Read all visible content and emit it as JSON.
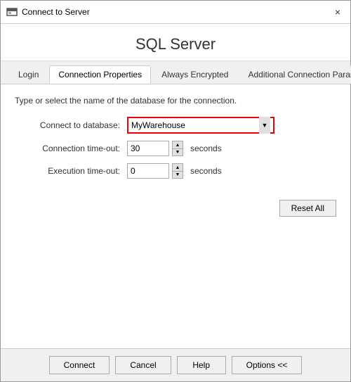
{
  "window": {
    "title": "Connect to Server",
    "close_label": "×"
  },
  "header": {
    "title": "SQL Server"
  },
  "tabs": [
    {
      "id": "login",
      "label": "Login",
      "active": false
    },
    {
      "id": "connection-properties",
      "label": "Connection Properties",
      "active": true
    },
    {
      "id": "always-encrypted",
      "label": "Always Encrypted",
      "active": false
    },
    {
      "id": "additional-connection-parameters",
      "label": "Additional Connection Parameters",
      "active": false
    }
  ],
  "content": {
    "description": "Type or select the name of the database for the connection.",
    "fields": [
      {
        "label": "Connect to database:",
        "type": "dropdown",
        "value": "MyWarehouse"
      },
      {
        "label": "Connection time-out:",
        "type": "spinner",
        "value": "30",
        "suffix": "seconds"
      },
      {
        "label": "Execution time-out:",
        "type": "spinner",
        "value": "0",
        "suffix": "seconds"
      }
    ],
    "reset_button": "Reset All"
  },
  "footer": {
    "connect_label": "Connect",
    "cancel_label": "Cancel",
    "help_label": "Help",
    "options_label": "Options <<"
  }
}
